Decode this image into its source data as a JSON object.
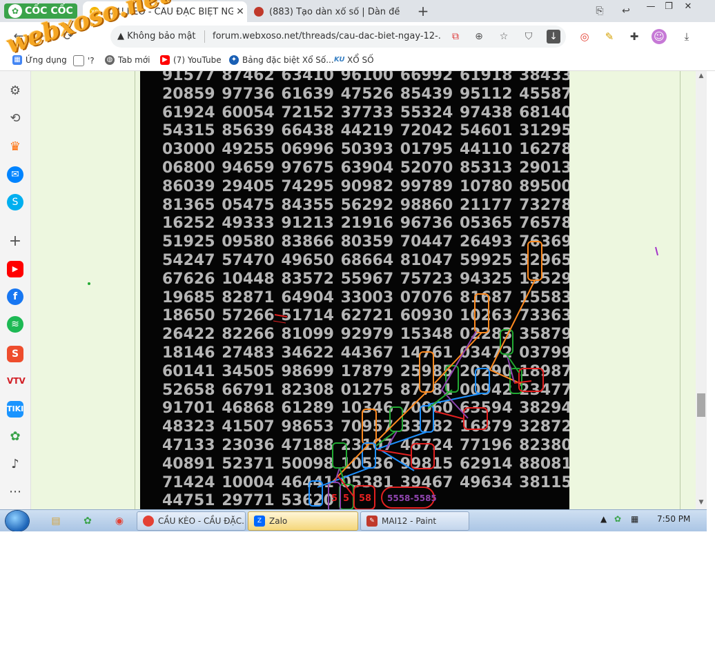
{
  "browser": {
    "brand": "CỐC CỐC",
    "tabs": [
      {
        "title": "CẦU KÈO - CẦU ĐẶC BIỆT NGÀY",
        "favicon": "XS",
        "favicon_color": "#f4b400",
        "active": true
      },
      {
        "title": "(883) Tạo dàn xổ số | Dàn đề",
        "favicon": "",
        "favicon_color": "#c0392b",
        "active": false
      }
    ],
    "new_tab_label": "+",
    "address": {
      "security_label": "Không bảo mật",
      "url": "forum.webxoso.net/threads/cau-dac-biet-ngay-12-..."
    },
    "bookmarks": [
      {
        "label": "Ứng dụng",
        "icon": "apps-icon",
        "color": "#4285f4"
      },
      {
        "label": "'?",
        "icon": "folder-icon",
        "color": "#777777"
      },
      {
        "label": "Tab mới",
        "icon": "globe-icon",
        "color": "#555555"
      },
      {
        "label": "(7) YouTube",
        "icon": "youtube-icon",
        "color": "#ff0000"
      },
      {
        "label": "Bảng đặc biệt Xổ Số...",
        "icon": "xs-icon",
        "color": "#1a5fb4"
      },
      {
        "label": "XỔ SỐ",
        "icon": "ku-icon",
        "color": "#3b82c4"
      }
    ],
    "watermark": "webxoso.net"
  },
  "sidebar": {
    "items": [
      {
        "icon": "settings-icon",
        "glyph": "⚙",
        "color": "#555555"
      },
      {
        "icon": "history-icon",
        "glyph": "⟲",
        "color": "#555555"
      },
      {
        "icon": "crown-icon",
        "glyph": "♛",
        "color": "#ff6a00"
      },
      {
        "icon": "messenger-icon",
        "glyph": "✉",
        "color": "#0084ff"
      },
      {
        "icon": "skype-icon",
        "glyph": "S",
        "color": "#00aff0"
      },
      {
        "icon": "add-icon",
        "glyph": "+",
        "color": "#555555"
      },
      {
        "icon": "youtube-icon",
        "glyph": "▶",
        "color": "#ff0000"
      },
      {
        "icon": "facebook-icon",
        "glyph": "f",
        "color": "#1877f2"
      },
      {
        "icon": "spotify-icon",
        "glyph": "≋",
        "color": "#1db954"
      },
      {
        "icon": "shopee-icon",
        "glyph": "S",
        "color": "#ee4d2d"
      },
      {
        "icon": "vtv-icon",
        "glyph": "V",
        "color": "#d21f26"
      },
      {
        "icon": "tiki-icon",
        "glyph": "T",
        "color": "#1a94ff"
      },
      {
        "icon": "coccoc-icon",
        "glyph": "●",
        "color": "#3aa34a"
      },
      {
        "icon": "bell-icon",
        "glyph": "🔔",
        "color": "#555555"
      },
      {
        "icon": "more-icon",
        "glyph": "⋯",
        "color": "#555555"
      }
    ]
  },
  "board": {
    "rows": [
      "91577 87462 63410 96100 66992 61918 38433",
      "20859 97736 61639 47526 85439 95112 45587",
      "61924 60054 72152 37733 55324 97438 68140",
      "54315 85639 66438 44219 72042 54601 31295",
      "03000 49255 06996 50393 01795 44110 16278",
      "06800 94659 97675 63904 52070 85313 29013",
      "86039 29405 74295 90982 99789 10780 89500",
      "81365 05475 84355 56292 98860 21177 73278",
      "16252 49333 91213 21916 96736 05365 76578",
      "51925 09580 83866 80359 70447 26493 76369",
      "54247 57470 49650 68664 81047 59925 32965",
      "67626 10448 83572 55967 75723 94325 13529",
      "19685 82871 64904 33003 07076 81687 15583",
      "18650 57266 51714 62721 60930 10263 73363",
      "26422 82266 81099 92979 15348 02283 35879",
      "18146 27483 34622 44367 14761 03472 03799",
      "60141 34505 98699 17879 25985 20290 18987",
      "52658 66791 82308 01275 87781 00942 23477",
      "91701 46868 61289 10346 70060 63594 38294",
      "48323 41507 98653 70957 33782 16879 32872",
      "47133 23036 47188 23107 46724 77196 82380",
      "40891 52371 50098 10536 99815 62914 88081",
      "71424 10004 46441 05381 39467 49634 38115",
      "44751 29771 53620"
    ],
    "annotations": {
      "label_5a": "5",
      "label_5b": "5",
      "label_58": "58",
      "label_range": "5558-5585"
    }
  },
  "taskbar": {
    "buttons": [
      {
        "label": "CẦU KÈO - CẦU ĐẶC...",
        "icon": "chrome-icon",
        "color": "#e44134"
      },
      {
        "label": "Zalo",
        "icon": "zalo-icon",
        "color": "#0068ff"
      },
      {
        "label": "MAI12 - Paint",
        "icon": "paint-icon",
        "color": "#c0392b"
      }
    ],
    "clock": "7:50 PM"
  }
}
